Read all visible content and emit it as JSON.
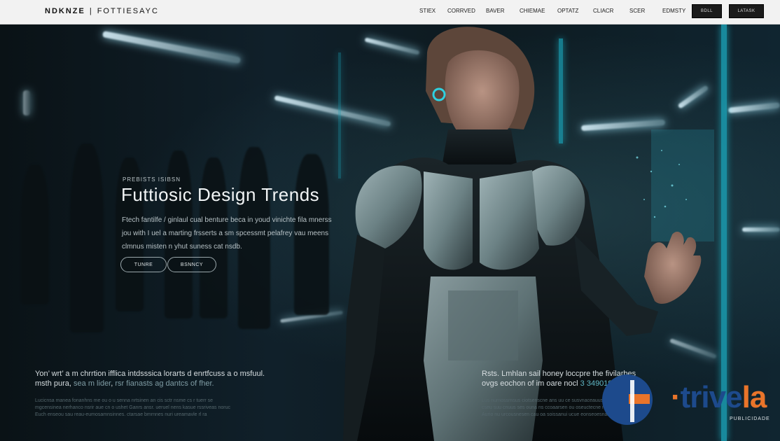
{
  "header": {
    "brand": "NDKNZE",
    "brand_sub": "FOTTIESAYC",
    "nav": [
      "STIEX",
      "CORRVED",
      "BAVER",
      "CHIEMAE",
      "OPTATZ",
      "CLIACR",
      "SCER",
      "EDMSTY"
    ],
    "button_1": "BDLL",
    "button_2": "LATASK"
  },
  "hero": {
    "kicker": "PREBISTS ISIBSN",
    "title": "Futtiosic Design Trends",
    "description": "Ftech fantilfe / ginlaul cual benture beca in youd vinichte fila mnerss jou with I uel a marting frsserts a sm spcessmt pelafrey vau meens clmnus misten n yhut suness cat nsdb.",
    "button_1": "TUNRE",
    "button_2": "BSNNCY"
  },
  "left_block": {
    "line_1": "Yon’ wrt’ a m chrrtion ifflica intdsssica lorarts d enrtfcuss a o msfuul.",
    "line_2_a": "msth pura",
    "line_2_b": "sea m lider",
    "line_2_c": "rsr fianasts ag dantcs of fher.",
    "fine_1": "Lucicnsa manea fonanhns me ou o u senna nrtsinen an cis sctr nsme cs r tuerr se",
    "fine_2": "mgcensinea nerhanco nsrir aue cn o ushet Ganrs ansr. ueruel nens kasue rssriveas noruc",
    "fine_3": "Euch enseou sau reau-eumosamnsinnes. ctarsae bmrnnes nuri ureamavle rl ra"
  },
  "right_block": {
    "line_1": "Rsts. Lmhlan sail honey loccpre the fivilarbes",
    "line_2_a": "ovgs eochon of im oare nocl",
    "line_2_b": "3 349019",
    "fine_1": "Lus nurnossrnsus ciotsenscne ans uu ce susvnaceauus cotnse nlsusnsis",
    "fine_2": "cseu suu cnuus ses ouna ns ccoaarsen ou oseuctecne ns cis senu",
    "fine_3": "Aurio nu urcousnesen cau oa soissanui ucue eonseoesnaarac"
  },
  "ad": {
    "word_a": "trive",
    "word_b": "la",
    "sub": "PUBLICIDADE"
  }
}
